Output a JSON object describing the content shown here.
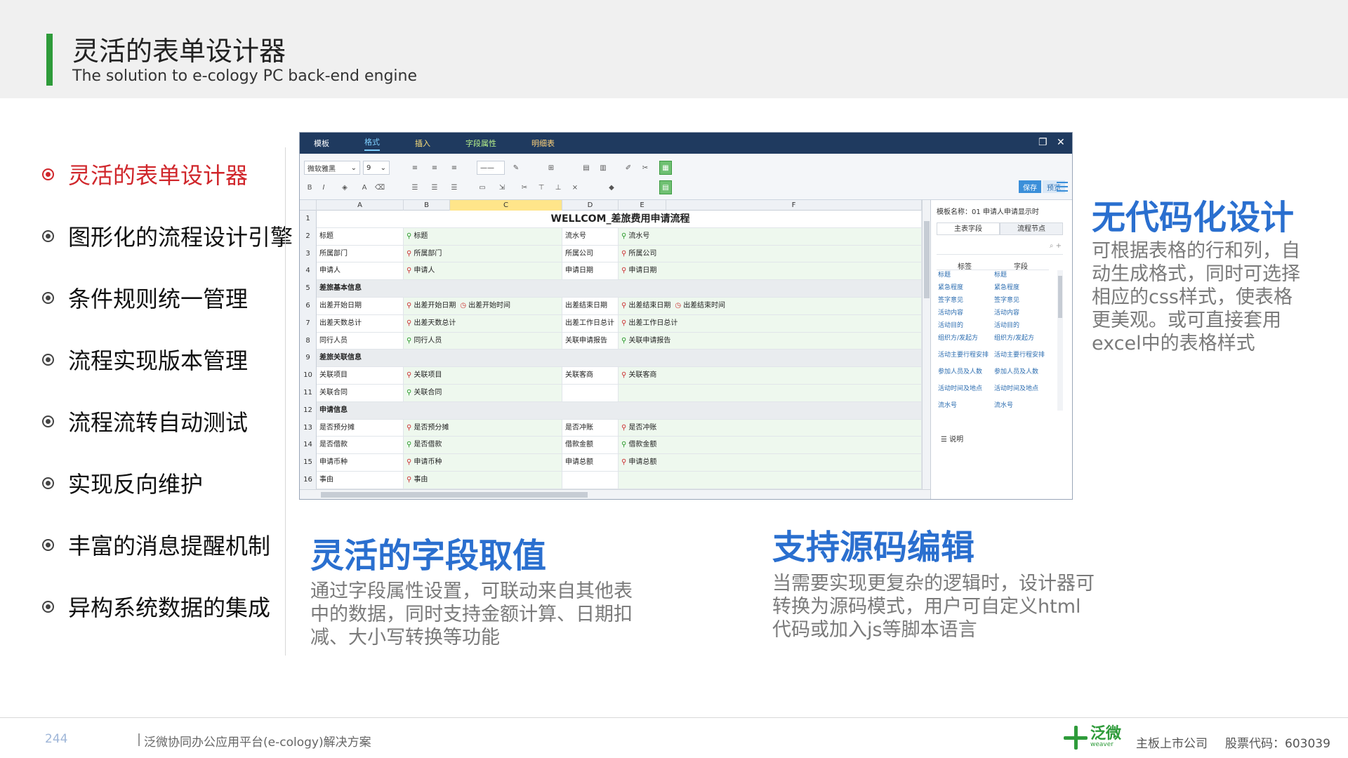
{
  "header": {
    "title": "灵活的表单设计器",
    "subtitle": "The solution to e-cology PC back-end engine"
  },
  "menu": [
    {
      "label": "灵活的表单设计器",
      "active": true
    },
    {
      "label": "图形化的流程设计引擎",
      "active": false
    },
    {
      "label": "条件规则统一管理",
      "active": false
    },
    {
      "label": "流程实现版本管理",
      "active": false
    },
    {
      "label": "流程流转自动测试",
      "active": false
    },
    {
      "label": "实现反向维护",
      "active": false
    },
    {
      "label": "丰富的消息提醒机制",
      "active": false
    },
    {
      "label": "异构系统数据的集成",
      "active": false
    }
  ],
  "designer": {
    "tabs": [
      "模板",
      "格式",
      "插入",
      "字段属性",
      "明细表"
    ],
    "active_tab": "格式",
    "font_name": "微软雅黑",
    "font_size": "9",
    "save_label": "保存",
    "preview_label": "预览",
    "columns": [
      "A",
      "B",
      "C",
      "D",
      "E",
      "F"
    ],
    "form_title": "WELLCOM_差旅费用申请流程",
    "rows": [
      {
        "num": "1"
      },
      {
        "num": "2",
        "a": "标题",
        "b": "标题",
        "d": "流水号",
        "e": "流水号"
      },
      {
        "num": "3",
        "a": "所属部门",
        "b": "所属部门",
        "d": "所属公司",
        "e": "所属公司"
      },
      {
        "num": "4",
        "a": "申请人",
        "b": "申请人",
        "d": "申请日期",
        "e": "申请日期"
      },
      {
        "num": "5",
        "section": "差旅基本信息"
      },
      {
        "num": "6",
        "a": "出差开始日期",
        "b": "出差开始日期",
        "c": "出差开始时间",
        "d": "出差结束日期",
        "e": "出差结束日期",
        "f": "出差结束时间"
      },
      {
        "num": "7",
        "a": "出差天数总计",
        "b": "出差天数总计",
        "d": "出差工作日总计",
        "e": "出差工作日总计"
      },
      {
        "num": "8",
        "a": "同行人员",
        "b": "同行人员",
        "d": "关联申请报告",
        "e": "关联申请报告"
      },
      {
        "num": "9",
        "section": "差旅关联信息"
      },
      {
        "num": "10",
        "a": "关联项目",
        "b": "关联项目",
        "d": "关联客商",
        "e": "关联客商"
      },
      {
        "num": "11",
        "a": "关联合同",
        "b": "关联合同"
      },
      {
        "num": "12",
        "section": "申请信息"
      },
      {
        "num": "13",
        "a": "是否预分摊",
        "b": "是否预分摊",
        "d": "是否冲账",
        "e": "是否冲账"
      },
      {
        "num": "14",
        "a": "是否借款",
        "b": "是否借款",
        "d": "借款金额",
        "e": "借款金额"
      },
      {
        "num": "15",
        "a": "申请币种",
        "b": "申请币种",
        "d": "申请总额",
        "e": "申请总额"
      },
      {
        "num": "16",
        "a": "事由",
        "b": "事由"
      }
    ],
    "panel": {
      "name": "模板名称：01 申请人申请显示时",
      "tabs": [
        "主表字段",
        "流程节点"
      ],
      "headers": [
        "标签",
        "字段"
      ],
      "fields": [
        [
          "标题",
          "标题"
        ],
        [
          "紧急程度",
          "紧急程度"
        ],
        [
          "签字意见",
          "签字意见"
        ],
        [
          "活动内容",
          "活动内容"
        ],
        [
          "活动目的",
          "活动目的"
        ],
        [
          "组织方/发起方",
          "组织方/发起方"
        ],
        [
          "活动主要行程安排",
          "活动主要行程安排"
        ],
        [
          "参加人员及人数",
          "参加人员及人数"
        ],
        [
          "活动时间及地点",
          "活动时间及地点"
        ],
        [
          "流水号",
          "流水号"
        ]
      ],
      "footer": "说明"
    }
  },
  "features": {
    "nocode": {
      "title": "无代码化设计",
      "desc": "可根据表格的行和列，自动生成格式，同时可选择相应的css样式，使表格更美观。或可直接套用excel中的表格样式"
    },
    "field": {
      "title": "灵活的字段取值",
      "desc": "通过字段属性设置，可联动来自其他表中的数据，同时支持金额计算、日期扣减、大小写转换等功能"
    },
    "source": {
      "title": "支持源码编辑",
      "desc": "当需要实现更复杂的逻辑时，设计器可转换为源码模式，用户可自定义html代码或加入js等脚本语言"
    }
  },
  "footer": {
    "page": "244",
    "text": "泛微协同办公应用平台(e-cology)解决方案",
    "brand": "泛微",
    "brand_en": "weaver",
    "listed": "主板上市公司",
    "stock": "股票代码：603039"
  },
  "colors": {
    "accent_green": "#2e9b3a",
    "active_red": "#d0262b",
    "heading_blue": "#2a6fcf"
  }
}
